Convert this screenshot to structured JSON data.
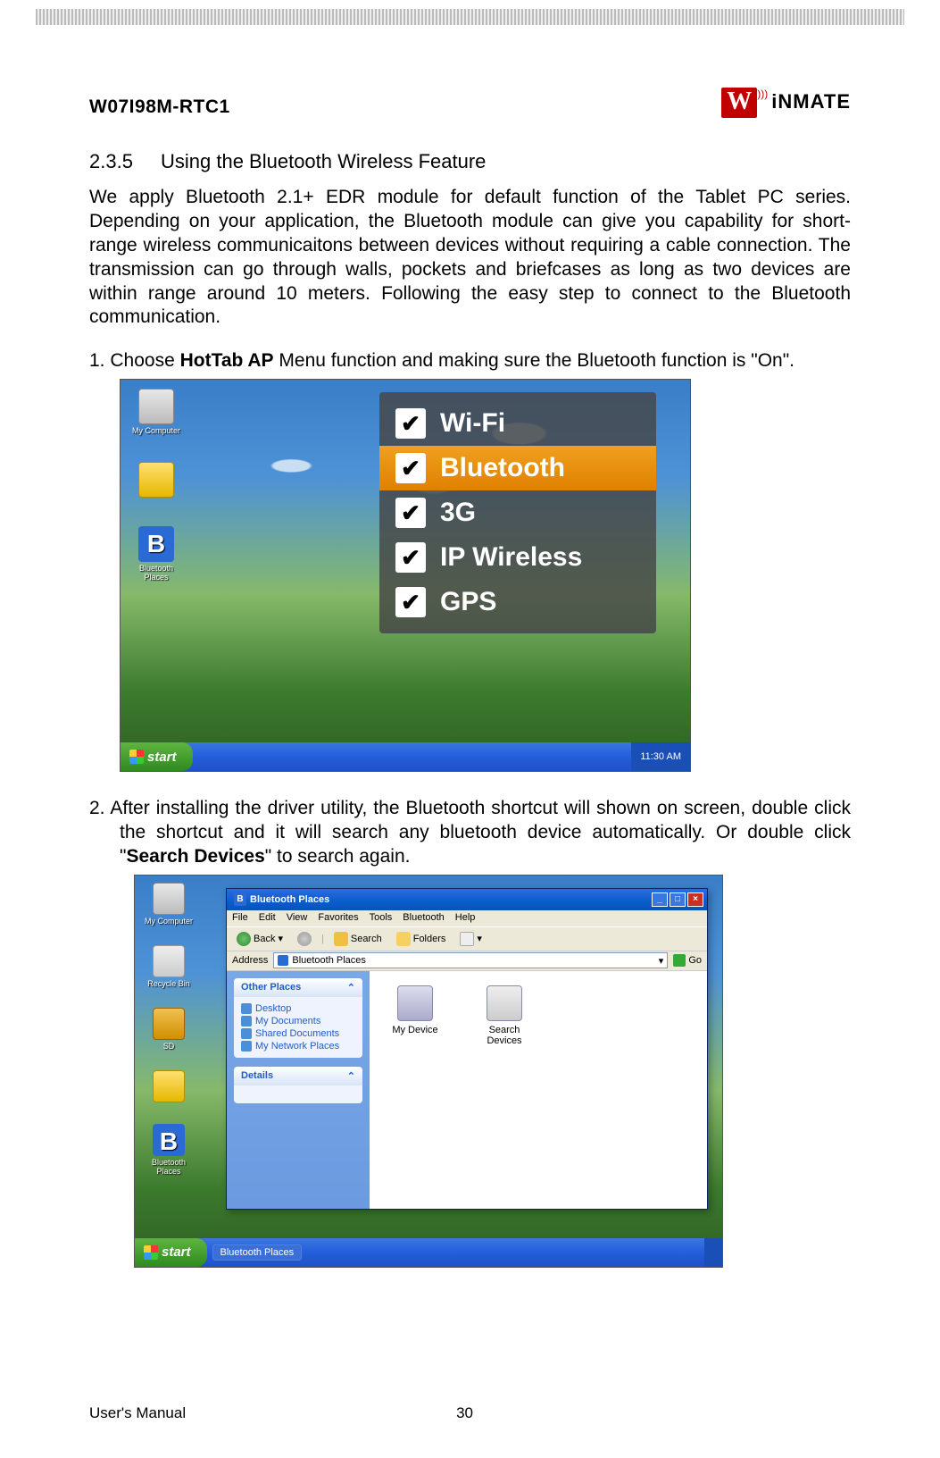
{
  "header": {
    "model": "W07I98M-RTC1",
    "brand_w": "W",
    "brand_rest": "iNMATE"
  },
  "section": {
    "number": "2.3.5",
    "title": "Using the Bluetooth Wireless Feature"
  },
  "intro": "We apply Bluetooth 2.1+ EDR module for default function of the Tablet PC series. Depending on your application, the Bluetooth module can give you capability for short-range wireless communicaitons between devices without requiring a cable connection. The transmission can go through walls, pockets and briefcases as long as two devices are within range around 10 meters. Following the easy step to connect to the Bluetooth communication.",
  "step1": {
    "num": "1.",
    "pre": "Choose ",
    "bold": "HotTab AP",
    "post": " Menu function and making sure the Bluetooth function is \"On\"."
  },
  "screenshot1": {
    "desktop_icons": [
      {
        "label": "My Computer",
        "cls": "ic-mycomp"
      },
      {
        "label": " ",
        "cls": "ic-folder"
      },
      {
        "label": "Bluetooth Places",
        "cls": "ic-bt",
        "glyph": "B"
      }
    ],
    "hottab": [
      {
        "label": "Wi-Fi",
        "checked": true,
        "selected": false
      },
      {
        "label": "Bluetooth",
        "checked": true,
        "selected": true
      },
      {
        "label": "3G",
        "checked": true,
        "selected": false
      },
      {
        "label": "IP Wireless",
        "checked": true,
        "selected": false
      },
      {
        "label": "GPS",
        "checked": true,
        "selected": false
      }
    ],
    "start": "start",
    "clock": "11:30 AM"
  },
  "step2": {
    "num": "2.",
    "pre": "After installing the driver utility, the Bluetooth shortcut will shown on screen, double click the shortcut and it will search any bluetooth device automatically. Or double click \"",
    "bold": "Search Devices",
    "post": "\" to search again."
  },
  "screenshot2": {
    "desktop_icons": [
      {
        "label": "My Computer",
        "cls": "ic-mycomp"
      },
      {
        "label": "Recycle Bin",
        "cls": "ic-recycle"
      },
      {
        "label": "SD",
        "cls": "ic-sd"
      },
      {
        "label": " ",
        "cls": "ic-folder"
      },
      {
        "label": "Bluetooth Places",
        "cls": "ic-bt",
        "glyph": "B"
      }
    ],
    "window": {
      "title": "Bluetooth Places",
      "menus": [
        "File",
        "Edit",
        "View",
        "Favorites",
        "Tools",
        "Bluetooth",
        "Help"
      ],
      "toolbar": {
        "back": "Back",
        "search": "Search",
        "folders": "Folders"
      },
      "address_label": "Address",
      "address_value": "Bluetooth Places",
      "go": "Go",
      "side_other_head": "Other Places",
      "side_other_items": [
        "Desktop",
        "My Documents",
        "Shared Documents",
        "My Network Places"
      ],
      "side_details_head": "Details",
      "devices": [
        {
          "label": "My Device"
        },
        {
          "label": "Search Devices"
        }
      ]
    },
    "start": "start",
    "task": "Bluetooth Places",
    "clock": " "
  },
  "footer": {
    "left": "User's Manual",
    "page": "30"
  }
}
